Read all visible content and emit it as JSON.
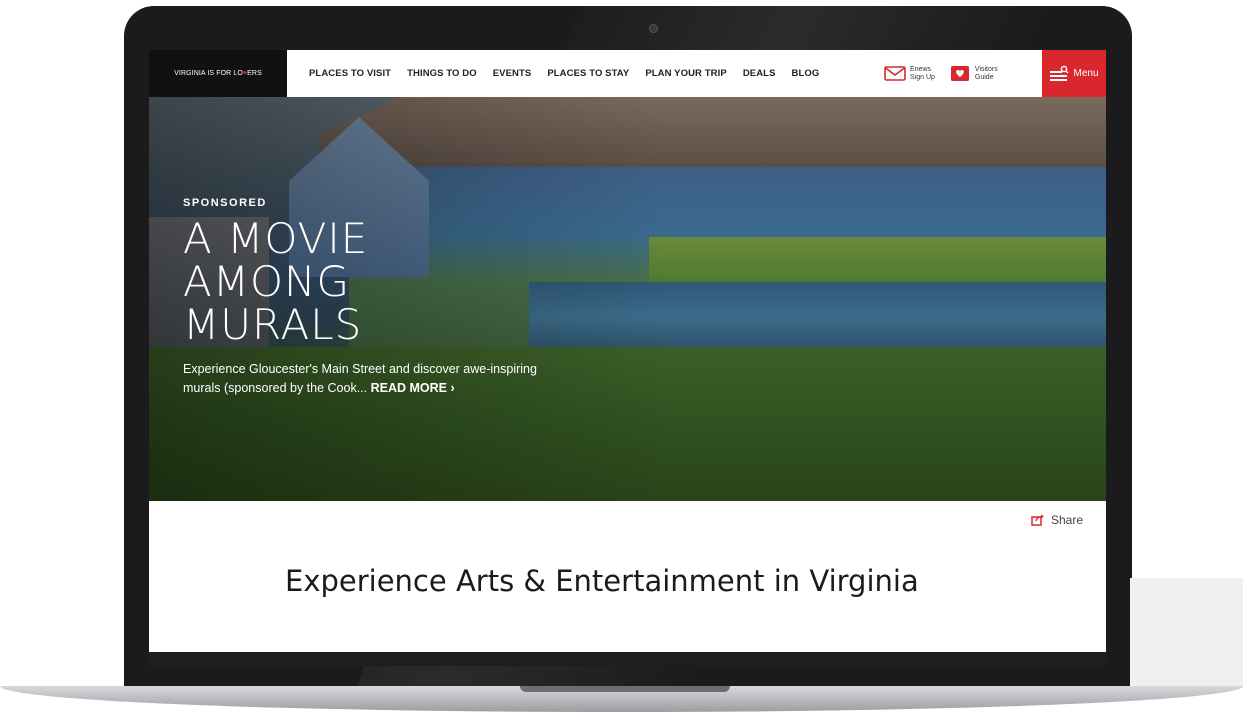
{
  "header": {
    "logo_prefix": "VIRGINIA IS FOR LO",
    "logo_heart": "♥",
    "logo_suffix": "ERS",
    "nav": [
      "PLACES TO VISIT",
      "THINGS TO DO",
      "EVENTS",
      "PLACES TO STAY",
      "PLAN YOUR TRIP",
      "DEALS",
      "BLOG"
    ],
    "enews_line1": "Enews",
    "enews_line2": "Sign Up",
    "guide_line1": "Visitors",
    "guide_line2": "Guide",
    "menu_label": "Menu",
    "brand_red": "#d9272e"
  },
  "hero": {
    "kicker": "SPONSORED",
    "title_line1": "A MOVIE",
    "title_line2": "AMONG",
    "title_line3": "MURALS",
    "body": "Experience Gloucester's Main Street and discover awe-inspiring murals (sponsored by the Cook... ",
    "more_label": "READ MORE ›"
  },
  "share_label": "Share",
  "section_title": "Experience Arts & Entertainment in Virginia"
}
